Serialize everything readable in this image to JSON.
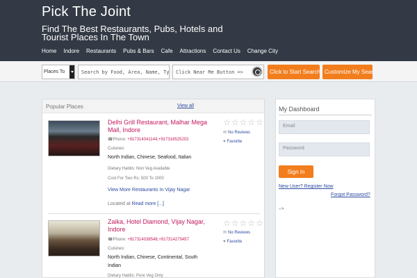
{
  "header": {
    "title": "Pick The Joint",
    "tagline": "Find The Best Restaurants, Pubs, Hotels and Tourist Places In The Town",
    "nav": [
      "Home",
      "Indore",
      "Restaurants",
      "Pubs & Bars",
      "Cafe",
      "Attractions",
      "Contact Us",
      "Change City"
    ]
  },
  "search": {
    "type_select": "Places To",
    "query_placeholder": "Search by Food, Area, Name, Type",
    "near_placeholder": "Click Near Me Button  =>",
    "near_me_icon": "crosshair-icon",
    "start_button": "Click to Start Search",
    "customize_button": "Customize My Search"
  },
  "popular": {
    "title": "Popular Places",
    "view_all": "View all",
    "places": [
      {
        "name": "Delhi Grill Restaurant, Malhar Mega Mall, Indore",
        "phone_label": "Phone:",
        "phone": "+917314041144,+917316525202",
        "cuisines_label": "Cuisines:",
        "cuisines": "North Indian, Chinese, Seafood, Italian",
        "dietary": "Dietary Habits: Non Veg Available",
        "cost": "Cost For Two Rs: 500 To 1000",
        "more_link": "View More Restaurants In Vijay Nagar",
        "located_prefix": "Located at",
        "read_more": "Read more [...]",
        "reviews": "No Reviews",
        "favorite": "Favorite",
        "rating": 0,
        "rating_max": 5
      },
      {
        "name": "Zaika, Hotel Diamond, Vijay Nagar, Indore",
        "phone_label": "Phone:",
        "phone": "+917314038548,+917314279457",
        "cuisines_label": "Cuisines:",
        "cuisines": "North Indian, Chinese, Continental, South Indian",
        "dietary": "Dietary Habits: Pure Veg Only",
        "reviews": "No Reviews",
        "favorite": "Favorite",
        "rating": 0,
        "rating_max": 5
      }
    ]
  },
  "dashboard": {
    "title": "My Dashboard",
    "email_placeholder": "Email",
    "password_placeholder": "Password",
    "signin": "Sign In",
    "register": "New User? Register Now",
    "forgot": "Forgot Password?",
    "arrow_text": "-->"
  },
  "colors": {
    "header_bg": "#333a45",
    "accent": "#f27d1d",
    "place_name": "#c2185b",
    "link": "#2b4aa0"
  }
}
